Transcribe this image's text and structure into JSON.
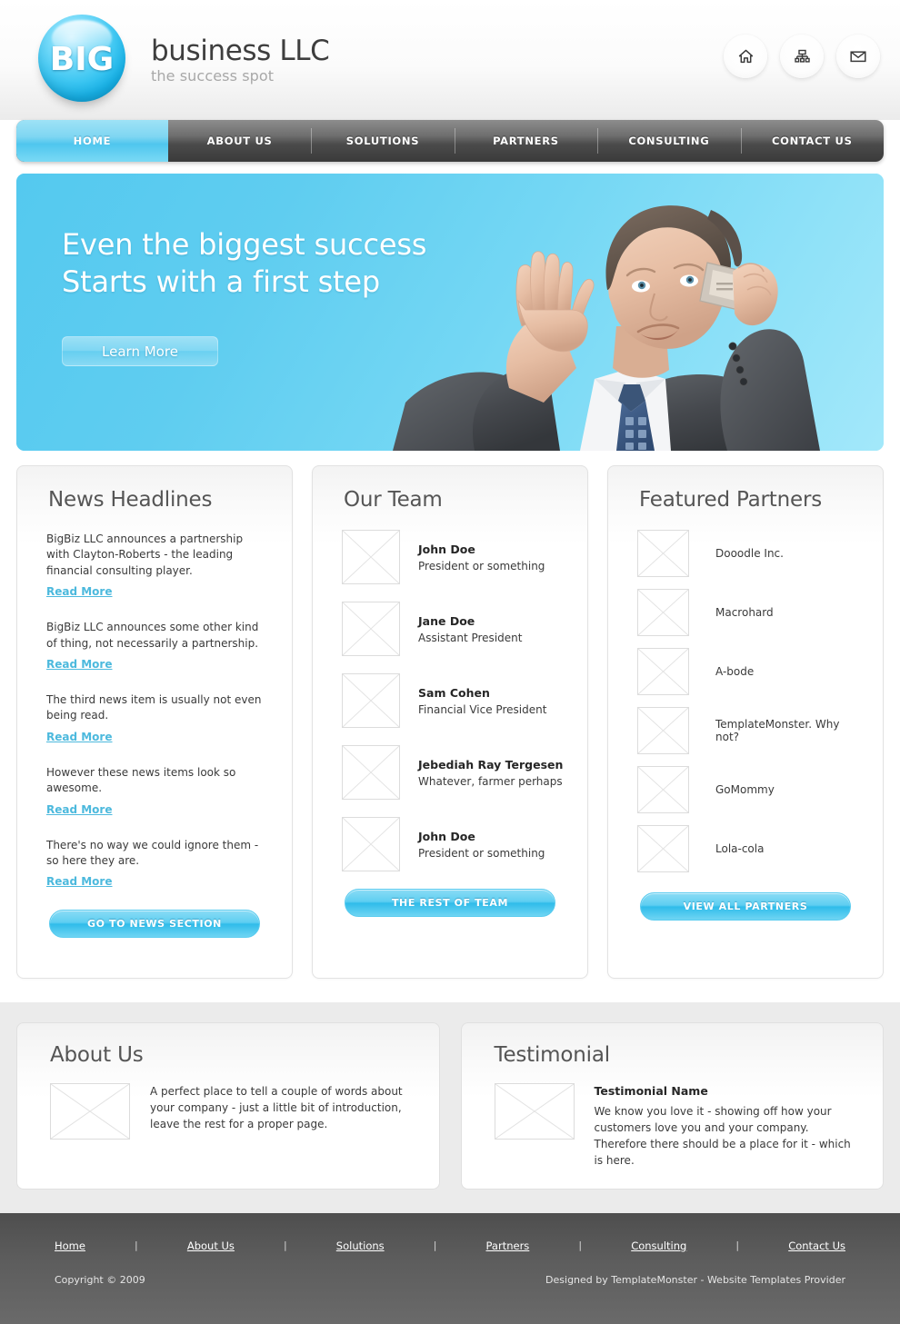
{
  "header": {
    "logo_badge": "BIG",
    "brand_title": "business LLC",
    "brand_tagline": "the success spot",
    "icons": [
      {
        "name": "home-icon"
      },
      {
        "name": "sitemap-icon"
      },
      {
        "name": "mail-icon"
      }
    ]
  },
  "nav": {
    "items": [
      {
        "label": "HOME",
        "active": true
      },
      {
        "label": "ABOUT US",
        "active": false
      },
      {
        "label": "SOLUTIONS",
        "active": false
      },
      {
        "label": "PARTNERS",
        "active": false
      },
      {
        "label": "CONSULTING",
        "active": false
      },
      {
        "label": "CONTACT US",
        "active": false
      }
    ]
  },
  "hero": {
    "headline_line1": "Even the biggest success",
    "headline_line2": "Starts with a first step",
    "cta_label": "Learn More",
    "background_color": "#5fcdf0"
  },
  "news": {
    "title": "News Headlines",
    "items": [
      {
        "text": "BigBiz LLC announces a partnership with Clayton-Roberts - the leading financial consulting player.",
        "link": "Read More"
      },
      {
        "text": "BigBiz LLC announces some other kind of thing, not necessarily a partnership.",
        "link": "Read More"
      },
      {
        "text": "The third news item is usually not even being read.",
        "link": "Read More"
      },
      {
        "text": "However these news items look so awesome.",
        "link": "Read More"
      },
      {
        "text": "There's no way  we could ignore them - so here they are.",
        "link": "Read More"
      }
    ],
    "button_label": "GO TO NEWS SECTION"
  },
  "team": {
    "title": "Our Team",
    "members": [
      {
        "name": "John Doe",
        "role": "President or something"
      },
      {
        "name": "Jane Doe",
        "role": "Assistant President"
      },
      {
        "name": "Sam Cohen",
        "role": "Financial Vice President"
      },
      {
        "name": "Jebediah Ray Tergesen",
        "role": "Whatever, farmer perhaps"
      },
      {
        "name": "John Doe",
        "role": "President or something"
      }
    ],
    "button_label": "THE REST OF TEAM"
  },
  "partners": {
    "title": "Featured Partners",
    "items": [
      {
        "name": "Dooodle Inc."
      },
      {
        "name": "Macrohard"
      },
      {
        "name": "A-bode"
      },
      {
        "name": "TemplateMonster. Why not?"
      },
      {
        "name": "GoMommy"
      },
      {
        "name": "Lola-cola"
      }
    ],
    "button_label": "VIEW ALL PARTNERS"
  },
  "about": {
    "title": "About Us",
    "text": "A perfect place to tell a couple of words about your company - just a little bit of introduction, leave the rest for a proper page."
  },
  "testimonial": {
    "title": "Testimonial",
    "name": "Testimonial Name",
    "text": "We know you love it - showing off how your customers love you and your company. Therefore there should be a place for it - which is here."
  },
  "footer": {
    "links": [
      {
        "label": "Home"
      },
      {
        "label": "About Us"
      },
      {
        "label": "Solutions"
      },
      {
        "label": "Partners"
      },
      {
        "label": "Consulting"
      },
      {
        "label": "Contact Us"
      }
    ],
    "separator": "|",
    "copyright": "Copyright © 2009",
    "credit": "Designed by TemplateMonster - Website Templates Provider"
  },
  "colors": {
    "accent": "#4cc5ef",
    "nav_dark": "#4b4b4b",
    "link": "#4cb9dd"
  }
}
